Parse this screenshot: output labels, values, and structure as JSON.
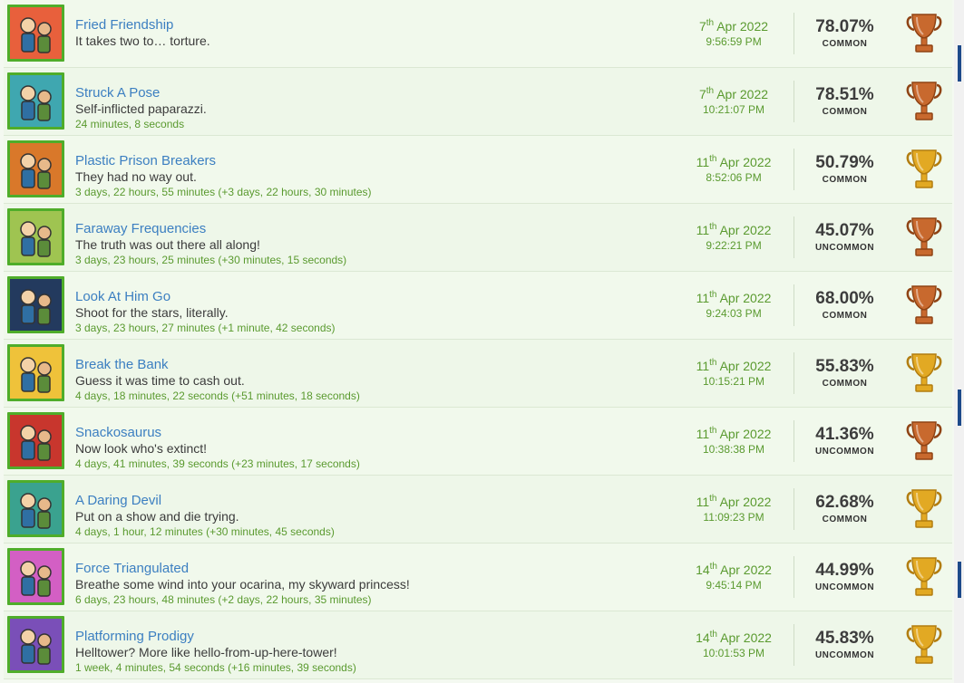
{
  "achievements": [
    {
      "title": "Fried Friendship",
      "desc": "It takes two to… torture.",
      "time": "",
      "day": "7",
      "suffix": "th",
      "monthyear": "Apr 2022",
      "clock": "9:56:59 PM",
      "pct": "78.07%",
      "rarity": "COMMON",
      "trophy": "bronze",
      "bg": "#e8603c",
      "icon": "fried-friendship-icon"
    },
    {
      "title": "Struck A Pose",
      "desc": "Self-inflicted paparazzi.",
      "time": "24 minutes, 8 seconds",
      "day": "7",
      "suffix": "th",
      "monthyear": "Apr 2022",
      "clock": "10:21:07 PM",
      "pct": "78.51%",
      "rarity": "COMMON",
      "trophy": "bronze",
      "bg": "#3fa7b0",
      "icon": "struck-a-pose-icon"
    },
    {
      "title": "Plastic Prison Breakers",
      "desc": "They had no way out.",
      "time": "3 days, 22 hours, 55 minutes (+3 days, 22 hours, 30 minutes)",
      "day": "11",
      "suffix": "th",
      "monthyear": "Apr 2022",
      "clock": "8:52:06 PM",
      "pct": "50.79%",
      "rarity": "COMMON",
      "trophy": "gold",
      "bg": "#d9782a",
      "icon": "plastic-prison-breakers-icon"
    },
    {
      "title": "Faraway Frequencies",
      "desc": "The truth was out there all along!",
      "time": "3 days, 23 hours, 25 minutes (+30 minutes, 15 seconds)",
      "day": "11",
      "suffix": "th",
      "monthyear": "Apr 2022",
      "clock": "9:22:21 PM",
      "pct": "45.07%",
      "rarity": "UNCOMMON",
      "trophy": "bronze",
      "bg": "#9fc451",
      "icon": "faraway-frequencies-icon"
    },
    {
      "title": "Look At Him Go",
      "desc": "Shoot for the stars, literally.",
      "time": "3 days, 23 hours, 27 minutes (+1 minute, 42 seconds)",
      "day": "11",
      "suffix": "th",
      "monthyear": "Apr 2022",
      "clock": "9:24:03 PM",
      "pct": "68.00%",
      "rarity": "COMMON",
      "trophy": "bronze",
      "bg": "#233a5e",
      "icon": "look-at-him-go-icon"
    },
    {
      "title": "Break the Bank",
      "desc": "Guess it was time to cash out.",
      "time": "4 days, 18 minutes, 22 seconds (+51 minutes, 18 seconds)",
      "day": "11",
      "suffix": "th",
      "monthyear": "Apr 2022",
      "clock": "10:15:21 PM",
      "pct": "55.83%",
      "rarity": "COMMON",
      "trophy": "gold",
      "bg": "#efc23a",
      "icon": "break-the-bank-icon"
    },
    {
      "title": "Snackosaurus",
      "desc": "Now look who's extinct!",
      "time": "4 days, 41 minutes, 39 seconds (+23 minutes, 17 seconds)",
      "day": "11",
      "suffix": "th",
      "monthyear": "Apr 2022",
      "clock": "10:38:38 PM",
      "pct": "41.36%",
      "rarity": "UNCOMMON",
      "trophy": "bronze",
      "bg": "#c8362d",
      "icon": "snackosaurus-icon"
    },
    {
      "title": "A Daring Devil",
      "desc": "Put on a show and die trying.",
      "time": "4 days, 1 hour, 12 minutes (+30 minutes, 45 seconds)",
      "day": "11",
      "suffix": "th",
      "monthyear": "Apr 2022",
      "clock": "11:09:23 PM",
      "pct": "62.68%",
      "rarity": "COMMON",
      "trophy": "gold",
      "bg": "#3aa28f",
      "icon": "a-daring-devil-icon"
    },
    {
      "title": "Force Triangulated",
      "desc": "Breathe some wind into your ocarina, my skyward princess!",
      "time": "6 days, 23 hours, 48 minutes (+2 days, 22 hours, 35 minutes)",
      "day": "14",
      "suffix": "th",
      "monthyear": "Apr 2022",
      "clock": "9:45:14 PM",
      "pct": "44.99%",
      "rarity": "UNCOMMON",
      "trophy": "gold",
      "bg": "#d35fc4",
      "icon": "force-triangulated-icon"
    },
    {
      "title": "Platforming Prodigy",
      "desc": "Helltower? More like hello-from-up-here-tower!",
      "time": "1 week, 4 minutes, 54 seconds (+16 minutes, 39 seconds)",
      "day": "14",
      "suffix": "th",
      "monthyear": "Apr 2022",
      "clock": "10:01:53 PM",
      "pct": "45.83%",
      "rarity": "UNCOMMON",
      "trophy": "gold",
      "bg": "#7a4fb8",
      "icon": "platforming-prodigy-icon"
    }
  ],
  "colors": {
    "bronze": "#c8692e",
    "gold": "#e2a923",
    "accent": "#4fad2a"
  }
}
